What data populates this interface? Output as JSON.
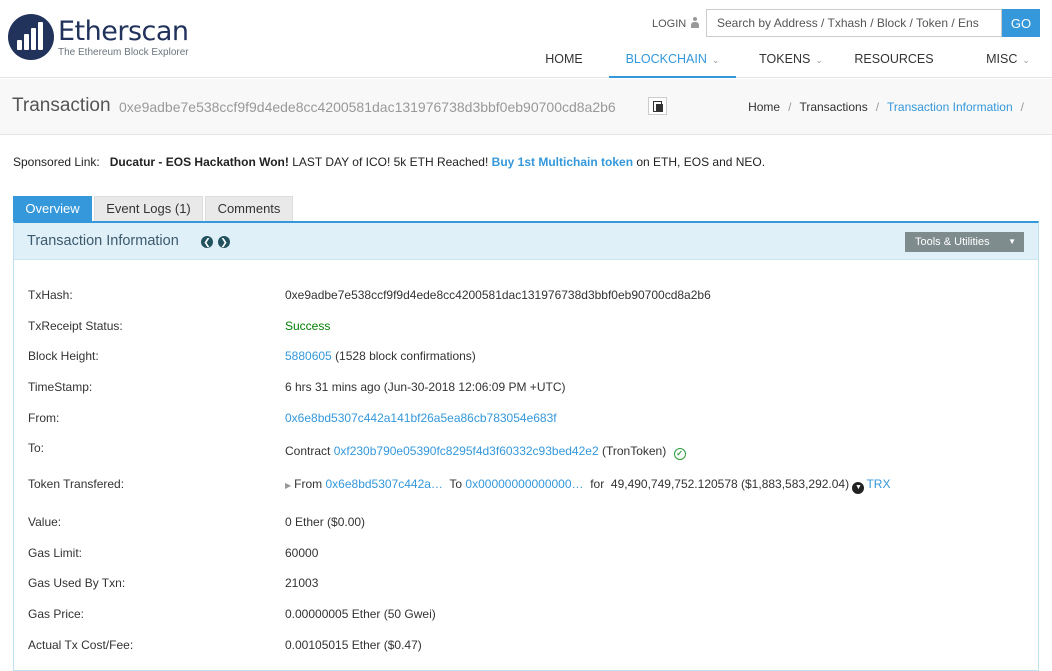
{
  "brand": {
    "name": "Etherscan",
    "tagline": "The Ethereum Block Explorer"
  },
  "header": {
    "login": "LOGIN",
    "search_placeholder": "Search by Address / Txhash / Block / Token / Ens",
    "go": "GO"
  },
  "nav": [
    {
      "label": "HOME"
    },
    {
      "label": "BLOCKCHAIN",
      "active": true
    },
    {
      "label": "TOKENS"
    },
    {
      "label": "RESOURCES"
    },
    {
      "label": "MISC"
    }
  ],
  "page": {
    "title": "Transaction",
    "hash": "0xe9adbe7e538ccf9f9d4ede8cc4200581dac131976738d3bbf0eb90700cd8a2b6"
  },
  "breadcrumb": [
    "Home",
    "Transactions",
    "Transaction Information"
  ],
  "sponsored": {
    "label": "Sponsored Link:",
    "bold": "Ducatur - EOS Hackathon Won!",
    "text": "LAST DAY of ICO! 5k ETH Reached!",
    "link": "Buy 1st Multichain token",
    "tail": "on ETH, EOS and NEO."
  },
  "tabs": [
    "Overview",
    "Event Logs (1)",
    "Comments"
  ],
  "panel": {
    "title": "Transaction Information",
    "tools": "Tools & Utilities"
  },
  "details": {
    "txhash": {
      "label": "TxHash:",
      "value": "0xe9adbe7e538ccf9f9d4ede8cc4200581dac131976738d3bbf0eb90700cd8a2b6"
    },
    "status": {
      "label": "TxReceipt Status:",
      "value": "Success"
    },
    "block": {
      "label": "Block Height:",
      "value": "5880605",
      "extra": "(1528 block confirmations)"
    },
    "timestamp": {
      "label": "TimeStamp:",
      "value": "6 hrs 31 mins ago (Jun-30-2018 12:06:09 PM +UTC)"
    },
    "from": {
      "label": "From:",
      "value": "0x6e8bd5307c442a141bf26a5ea86cb783054e683f"
    },
    "to": {
      "label": "To:",
      "prefix": "Contract",
      "value": "0xf230b790e05390fc8295f4d3f60332c93bed42e2",
      "suffix": "(TronToken)"
    },
    "token": {
      "label": "Token Transfered:",
      "from_label": "From",
      "from": "0x6e8bd5307c442a…",
      "to_label": "To",
      "to": "0x00000000000000…",
      "for_label": "for",
      "amount": "49,490,749,752.120578 ($1,883,583,292.04)",
      "symbol": "TRX"
    },
    "value": {
      "label": "Value:",
      "value": "0 Ether ($0.00)"
    },
    "gas_limit": {
      "label": "Gas Limit:",
      "value": "60000"
    },
    "gas_used": {
      "label": "Gas Used By Txn:",
      "value": "21003"
    },
    "gas_price": {
      "label": "Gas Price:",
      "value": "0.00000005 Ether (50 Gwei)"
    },
    "fee": {
      "label": "Actual Tx Cost/Fee:",
      "value": "0.00105015 Ether ($0.47)"
    }
  },
  "colors": {
    "accent": "#3498db",
    "brand": "#21325b",
    "success": "#008000"
  }
}
